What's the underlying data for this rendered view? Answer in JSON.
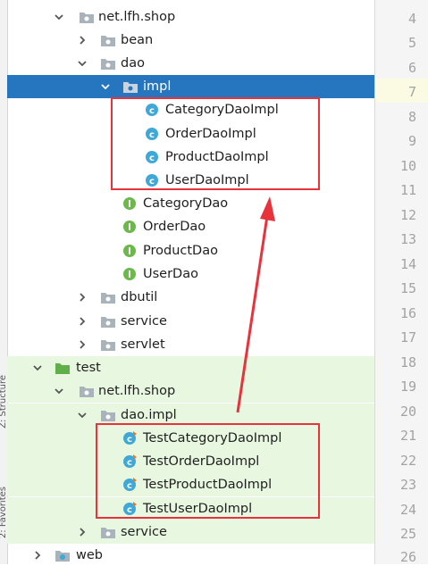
{
  "sidebar_tabs": {
    "structure": "Z: Structure",
    "favorites": "2: Favorites"
  },
  "tree": {
    "main_pkg": "net.lfh.shop",
    "bean": "bean",
    "dao": "dao",
    "impl": "impl",
    "impl_classes": [
      "CategoryDaoImpl",
      "OrderDaoImpl",
      "ProductDaoImpl",
      "UserDaoImpl"
    ],
    "interfaces": [
      "CategoryDao",
      "OrderDao",
      "ProductDao",
      "UserDao"
    ],
    "dbutil": "dbutil",
    "service": "service",
    "servlet": "servlet",
    "test": "test",
    "test_pkg": "net.lfh.shop",
    "test_dao_impl": "dao.impl",
    "test_classes": [
      "TestCategoryDaoImpl",
      "TestOrderDaoImpl",
      "TestProductDaoImpl",
      "TestUserDaoImpl"
    ],
    "test_service": "service",
    "web": "web"
  },
  "gutter": {
    "line_numbers": [
      "4",
      "5",
      "6",
      "7",
      "8",
      "9",
      "10",
      "11",
      "12",
      "13",
      "14",
      "15",
      "16",
      "17",
      "18",
      "19",
      "20",
      "21",
      "22",
      "23",
      "24",
      "25",
      "26"
    ]
  },
  "colors": {
    "selection": "#2675bf",
    "test_background": "#e8f8e0",
    "annotation_red": "#e8323c",
    "class_icon": "#3fa8d6",
    "interface_icon": "#6bb84b",
    "folder": "#a9b3bc",
    "test_folder": "#5fb04a"
  }
}
